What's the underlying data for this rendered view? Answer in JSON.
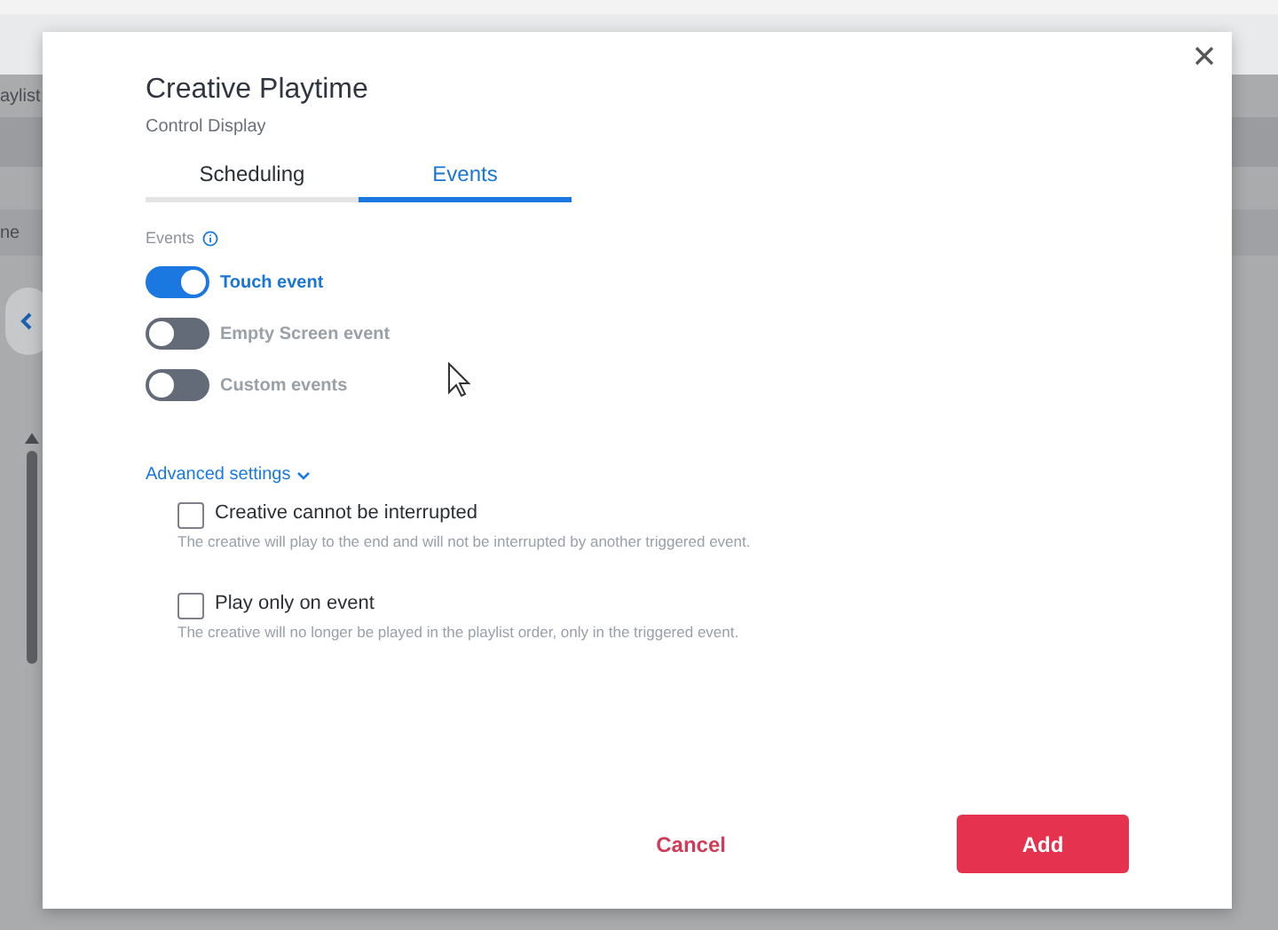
{
  "background": {
    "fragments": [
      "aylist",
      "ne"
    ]
  },
  "dialog": {
    "title": "Creative Playtime",
    "subtitle": "Control Display",
    "tabs": [
      {
        "label": "Scheduling",
        "selected": false
      },
      {
        "label": "Events",
        "selected": true
      }
    ],
    "events_label": "Events",
    "toggles": [
      {
        "label": "Touch event",
        "on": true
      },
      {
        "label": "Empty Screen event",
        "on": false
      },
      {
        "label": "Custom events",
        "on": false
      }
    ],
    "advanced": {
      "label": "Advanced settings",
      "expanded": true
    },
    "options": [
      {
        "label": "Creative cannot be interrupted",
        "description": "The creative will play to the end and will not be interrupted by another triggered event.",
        "checked": false
      },
      {
        "label": "Play only on event",
        "description": "The creative will no longer be played in the playlist order, only in the triggered event.",
        "checked": false
      }
    ],
    "buttons": {
      "cancel": "Cancel",
      "confirm": "Add"
    }
  }
}
